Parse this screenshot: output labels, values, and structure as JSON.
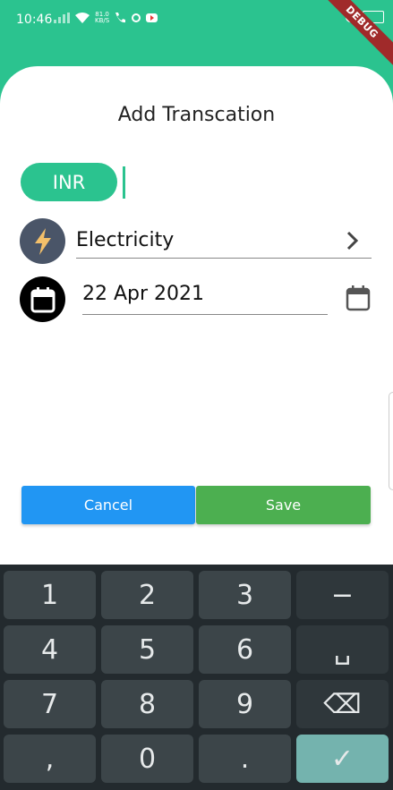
{
  "status_bar": {
    "time": "10:46",
    "net_speed_value": "81.0",
    "net_speed_unit": "KB/S",
    "debug_label": "DEBUG"
  },
  "header": {
    "title": "Add Transcation"
  },
  "form": {
    "currency": "INR",
    "category": "Electricity",
    "date": "22 Apr 2021"
  },
  "actions": {
    "cancel_label": "Cancel",
    "save_label": "Save"
  },
  "keyboard": {
    "rows": [
      [
        "1",
        "2",
        "3",
        "−"
      ],
      [
        "4",
        "5",
        "6",
        "␣"
      ],
      [
        "7",
        "8",
        "9",
        "⌫"
      ],
      [
        ",",
        "0",
        ".",
        "✓"
      ]
    ]
  },
  "colors": {
    "brand": "#2bc38f",
    "cancel": "#2196f3",
    "save": "#4caf50",
    "category_icon_bg": "#4a5568",
    "lightning": "#f4c06a"
  }
}
